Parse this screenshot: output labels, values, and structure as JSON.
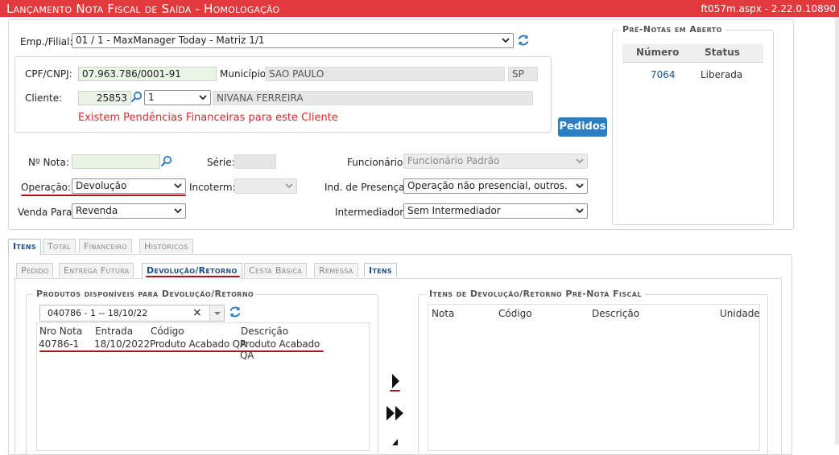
{
  "header": {
    "title": "Lançamento Nota Fiscal de Saída  - Homologação",
    "version": "ft057m.aspx - 2.22.0.10890"
  },
  "form": {
    "emp_label": "Emp./Filial:",
    "emp_value": "01 / 1 - MaxManager Today - Matriz 1/1",
    "cpf_label": "CPF/CNPJ:",
    "cpf_value": "07.963.786/0001-91",
    "municipio_label": "Município:",
    "municipio_value": "SAO PAULO",
    "uf_value": "SP",
    "cliente_label": "Cliente:",
    "cliente_code": "25853",
    "cliente_seq": "1",
    "cliente_name": "NIVANA FERREIRA",
    "pendencia_msg": "Existem Pendências Financeiras para este Cliente",
    "pedidos_button": "Pedidos",
    "nota_label": "Nº Nota:",
    "nota_value": "",
    "serie_label": "Série:",
    "serie_value": "",
    "funcionario_label": "Funcionário:",
    "funcionario_value": "Funcionário Padrão",
    "operacao_label": "Operação:",
    "operacao_value": "Devolução",
    "incoterm_label": "Incoterm:",
    "incoterm_value": "",
    "presenca_label": "Ind. de Presença:",
    "presenca_value": "Operação não presencial, outros.",
    "venda_label": "Venda Para:",
    "venda_value": "Revenda",
    "intermediador_label": "Intermediador:",
    "intermediador_value": "Sem Intermediador"
  },
  "prenotas": {
    "legend": "Pré-Notas em Aberto",
    "col_numero": "Número",
    "col_status": "Status",
    "rows": [
      {
        "numero": "7064",
        "status": "Liberada"
      }
    ]
  },
  "tabs_main": [
    "Itens",
    "Total",
    "Financeiro",
    "Históricos"
  ],
  "tabs_sub": [
    "Pedido",
    "Entrega Futura",
    "Devolução/Retorno",
    "Cesta Básica",
    "Remessa",
    "Itens"
  ],
  "produtos": {
    "legend": "Produtos disponíveis para Devolução/Retorno",
    "combo_value": "040786 - 1 -- 18/10/22",
    "combo_clear": "×",
    "col_nro": "Nro Nota",
    "col_entrada": "Entrada",
    "col_codigo": "Código",
    "col_descricao": "Descrição",
    "rows": [
      {
        "nro": "40786-1",
        "entrada": "18/10/2022",
        "codigo": "Produto Acabado QA",
        "descricao": "Produto Acabado QA"
      }
    ]
  },
  "itens_dev": {
    "legend": "Itens de Devolução/Retorno Pré-Nota Fiscal",
    "col_nota": "Nota",
    "col_codigo": "Código",
    "col_descricao": "Descrição",
    "col_unidade": "Unidade"
  },
  "colors": {
    "header_red": "#e23a3c",
    "accent_blue": "#2b7ec1",
    "alert_red": "#d22b2b",
    "tab_active": "#1c4f86"
  }
}
